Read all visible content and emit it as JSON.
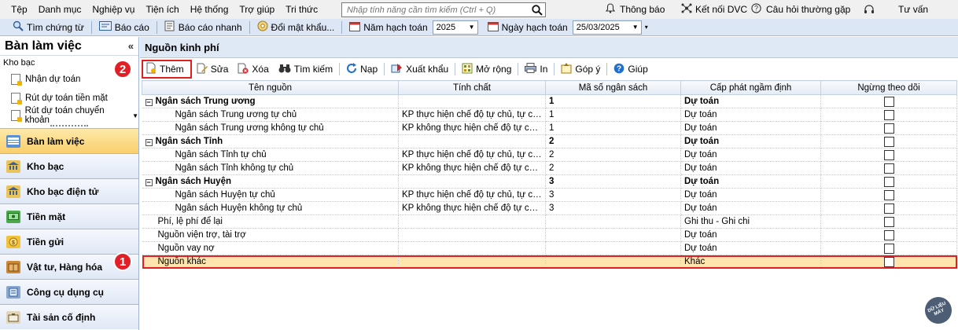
{
  "menu": [
    "Tệp",
    "Danh mục",
    "Nghiệp vụ",
    "Tiện ích",
    "Hệ thống",
    "Trợ giúp",
    "Tri thức"
  ],
  "search": {
    "placeholder": "Nhập tính năng cần tìm kiếm (Ctrl + Q)"
  },
  "right_menu": {
    "notifications": "Thông báo",
    "dvc": "Kết nối DVC",
    "faq": "Câu hỏi thường gặp",
    "consult": "Tư vấn"
  },
  "toolbar2": {
    "voucher_search": "Tìm chứng từ",
    "report": "Báo cáo",
    "quick_report": "Báo cáo nhanh",
    "change_password": "Đổi mật khẩu...",
    "fiscal_year_label": "Năm hạch toán",
    "fiscal_year_value": "2025",
    "posting_date_label": "Ngày hạch toán",
    "posting_date_value": "25/03/2025"
  },
  "sidebar": {
    "title": "Bàn làm việc",
    "section": "Kho bạc",
    "links": [
      "Nhận dự toán",
      "Rút dự toán tiền mặt",
      "Rút dự toán chuyển khoản"
    ],
    "nav": [
      {
        "label": "Bàn làm việc",
        "icon": "desk-icon",
        "active": true
      },
      {
        "label": "Kho bạc",
        "icon": "treasury-icon"
      },
      {
        "label": "Kho bạc điện tử",
        "icon": "e-treasury-icon"
      },
      {
        "label": "Tiền mặt",
        "icon": "cash-icon"
      },
      {
        "label": "Tiền gửi",
        "icon": "deposit-icon"
      },
      {
        "label": "Vật tư, Hàng hóa",
        "icon": "goods-icon"
      },
      {
        "label": "Công cụ dụng cụ",
        "icon": "tools-icon"
      },
      {
        "label": "Tài sản cố định",
        "icon": "fixed-asset-icon"
      }
    ]
  },
  "content": {
    "title": "Nguồn kinh phí",
    "toolbar": {
      "add": "Thêm",
      "edit": "Sửa",
      "delete": "Xóa",
      "search": "Tìm kiếm",
      "reload": "Nạp",
      "export": "Xuất khẩu",
      "expand": "Mở rộng",
      "print": "In",
      "feedback": "Góp ý",
      "help": "Giúp"
    },
    "columns": [
      "Tên nguồn",
      "Tính chất",
      "Mã số ngân sách",
      "Cấp phát ngầm định",
      "Ngừng theo dõi"
    ],
    "rows": [
      {
        "name": "Ngân sách Trung ương",
        "nature": "",
        "code": "1",
        "default": "Dự toán",
        "level": "group"
      },
      {
        "name": "Ngân sách Trung ương tự chủ",
        "nature": "KP thực hiện chế độ tự chủ, tự chịu...",
        "code": "1",
        "default": "Dự toán",
        "level": "l1"
      },
      {
        "name": "Ngân sách Trung ương không tự chủ",
        "nature": "KP không thực hiện chế độ tự chủ,...",
        "code": "1",
        "default": "Dự toán",
        "level": "l1"
      },
      {
        "name": "Ngân sách Tỉnh",
        "nature": "",
        "code": "2",
        "default": "Dự toán",
        "level": "group"
      },
      {
        "name": "Ngân sách Tỉnh tự chủ",
        "nature": "KP thực hiện chế độ tự chủ, tự chịu...",
        "code": "2",
        "default": "Dự toán",
        "level": "l1"
      },
      {
        "name": "Ngân sách Tỉnh không tự chủ",
        "nature": "KP không thực hiện chế độ tự chủ,...",
        "code": "2",
        "default": "Dự toán",
        "level": "l1"
      },
      {
        "name": "Ngân sách Huyện",
        "nature": "",
        "code": "3",
        "default": "Dự toán",
        "level": "group"
      },
      {
        "name": "Ngân sách Huyện tự chủ",
        "nature": "KP thực hiện chế độ tự chủ, tự chịu...",
        "code": "3",
        "default": "Dự toán",
        "level": "l1"
      },
      {
        "name": "Ngân sách Huyện không tự chủ",
        "nature": "KP không thực hiện chế độ tự chủ,...",
        "code": "3",
        "default": "Dự toán",
        "level": "l1"
      },
      {
        "name": "Phí, lệ phí để lại",
        "nature": "",
        "code": "",
        "default": "Ghi thu - Ghi chi",
        "level": "l0"
      },
      {
        "name": "Nguồn viện trợ, tài trợ",
        "nature": "",
        "code": "",
        "default": "Dự toán",
        "level": "l0"
      },
      {
        "name": "Nguồn vay nợ",
        "nature": "",
        "code": "",
        "default": "Dự toán",
        "level": "l0"
      },
      {
        "name": "Nguồn khác",
        "nature": "",
        "code": "",
        "default": "Khác",
        "level": "l0",
        "selected": true
      }
    ]
  },
  "annotations": [
    "1",
    "2"
  ],
  "watermark": "DỮ LIỆU MÁY"
}
